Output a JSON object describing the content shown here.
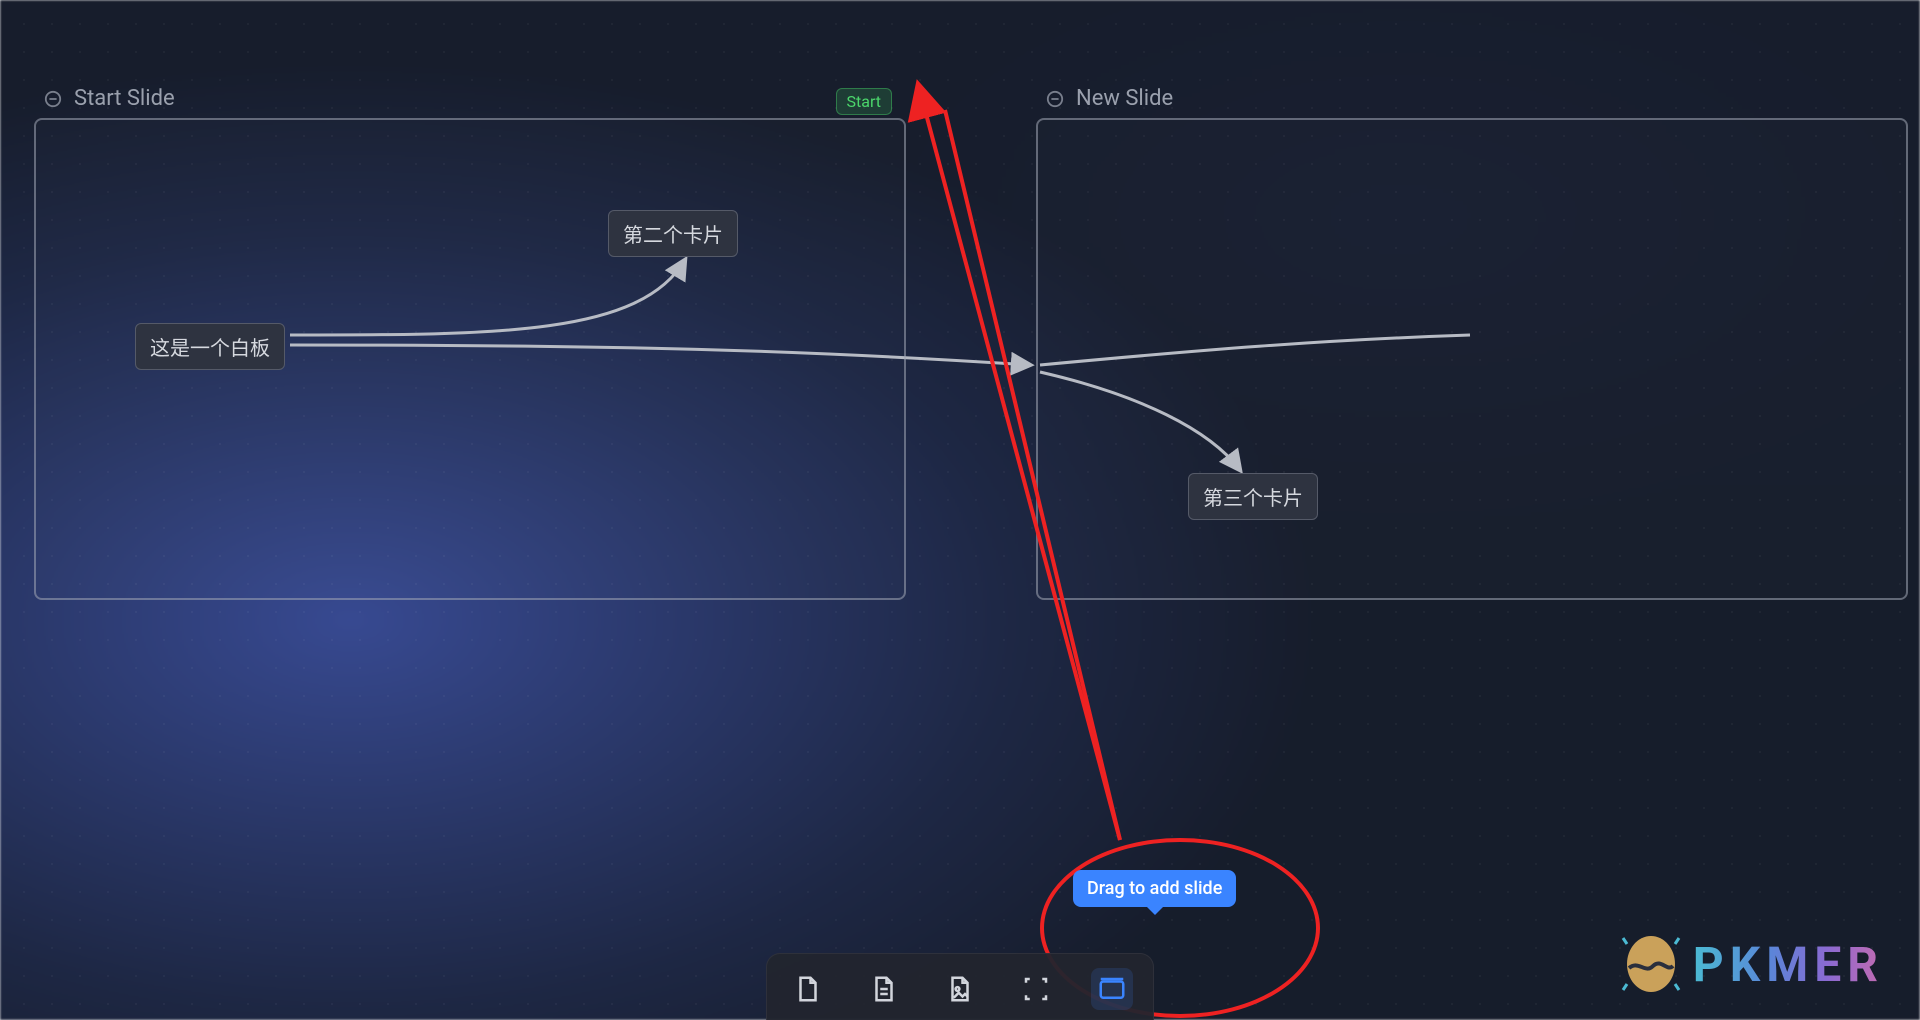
{
  "slides": {
    "start": {
      "title": "Start Slide",
      "badge": "Start"
    },
    "new": {
      "title": "New Slide"
    }
  },
  "cards": {
    "c1": "这是一个白板",
    "c2": "第二个卡片",
    "c3": "第三个卡片"
  },
  "tooltip": {
    "add_slide": "Drag to add slide"
  },
  "toolbar": {
    "tools": {
      "blank_card": "blank-card",
      "note_card": "note-card",
      "image_card": "image-card",
      "group": "group-selection",
      "slide": "add-slide"
    }
  },
  "watermark": {
    "text": "PKMER"
  },
  "colors": {
    "accent": "#3a84ff",
    "annotation": "#e22",
    "badge_text": "#4bd66b"
  }
}
